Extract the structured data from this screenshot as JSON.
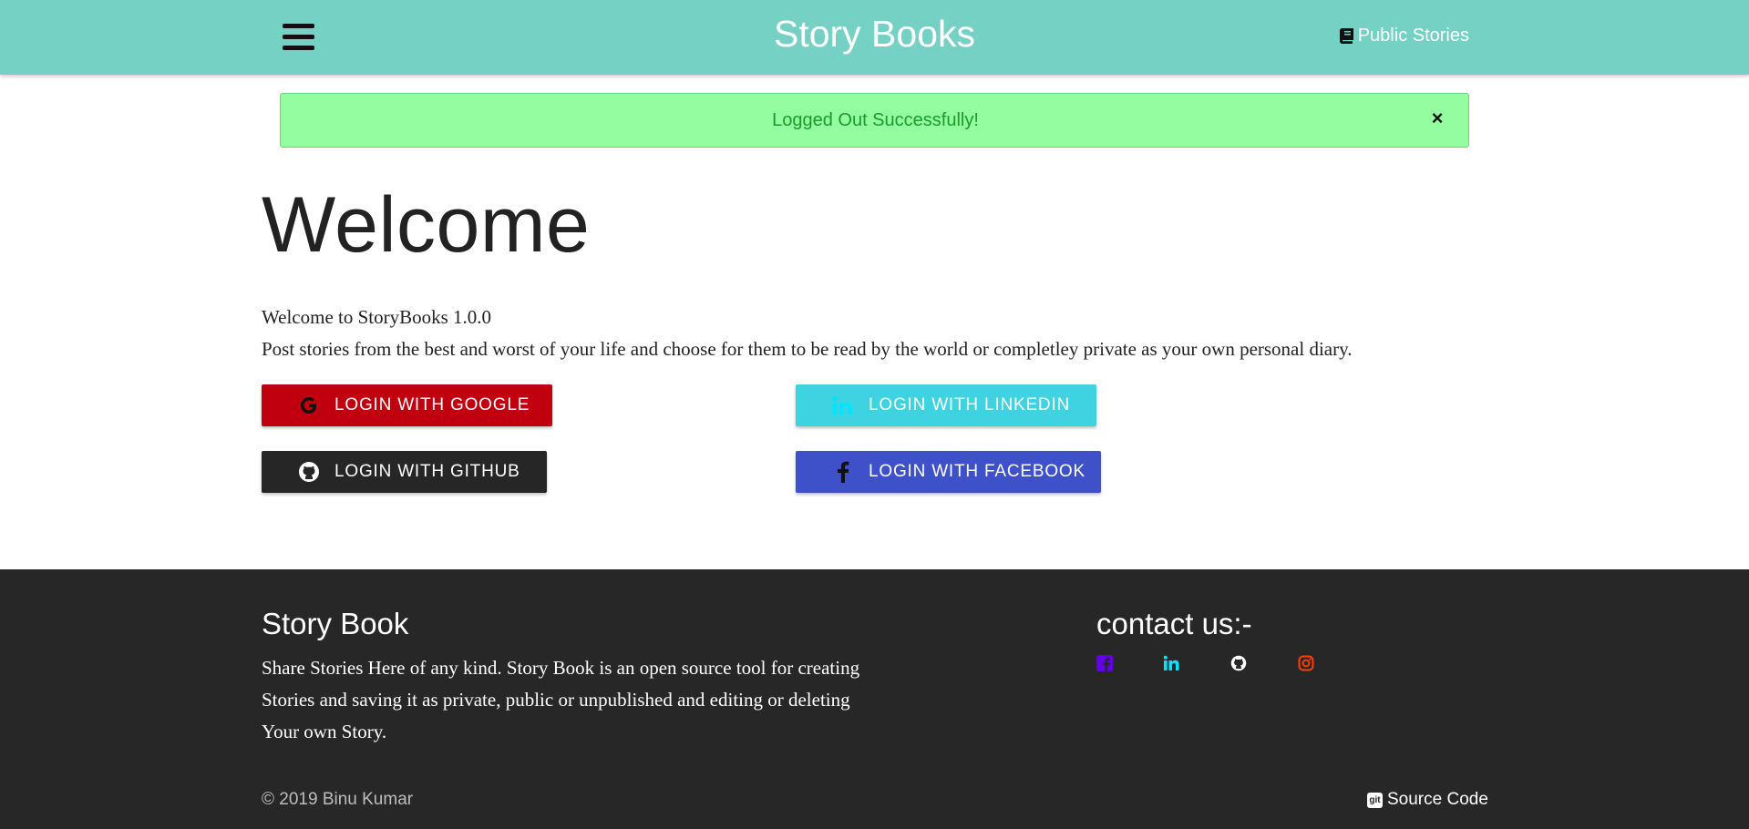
{
  "navbar": {
    "brand": "Story Books",
    "public_stories_label": "Public Stories",
    "bg_color": "#76d1c5"
  },
  "alert": {
    "message": "Logged Out Successfully!",
    "close_label": "×",
    "bg_color": "#93fd9f"
  },
  "main": {
    "title": "Welcome",
    "version_line": "Welcome to StoryBooks 1.0.0",
    "description": "Post stories from the best and worst of your life and choose for them to be read by the world or completley private as your own personal diary."
  },
  "login": {
    "google": {
      "label": "LOGIN WITH GOOGLE",
      "icon": "google-icon",
      "color": "#c0000e"
    },
    "linkedin": {
      "label": "LOGIN WITH LINKEDIN",
      "icon": "linkedin-icon",
      "color": "#3fd2e0"
    },
    "github": {
      "label": "LOGIN WITH GITHUB",
      "icon": "github-icon",
      "color": "#262626"
    },
    "facebook": {
      "label": "LOGIN WITH FACEBOOK",
      "icon": "facebook-icon",
      "color": "#3f51c8"
    }
  },
  "footer": {
    "title": "Story Book",
    "description": "Share Stories Here of any kind. Story Book is an open source tool for creating Stories and saving it as private, public or unpublished and editing or deleting Your own Story.",
    "contact_title": "contact us:-",
    "social": [
      {
        "icon": "facebook-square-icon",
        "color": "#6200ea"
      },
      {
        "icon": "linkedin-icon",
        "color": "#00e5ff"
      },
      {
        "icon": "github-icon",
        "color": "#ffffff"
      },
      {
        "icon": "instagram-icon",
        "color": "#ff3d00"
      }
    ],
    "copyright": "© 2019 Binu Kumar",
    "source_code_label": "Source Code",
    "bg_color": "#272727"
  }
}
